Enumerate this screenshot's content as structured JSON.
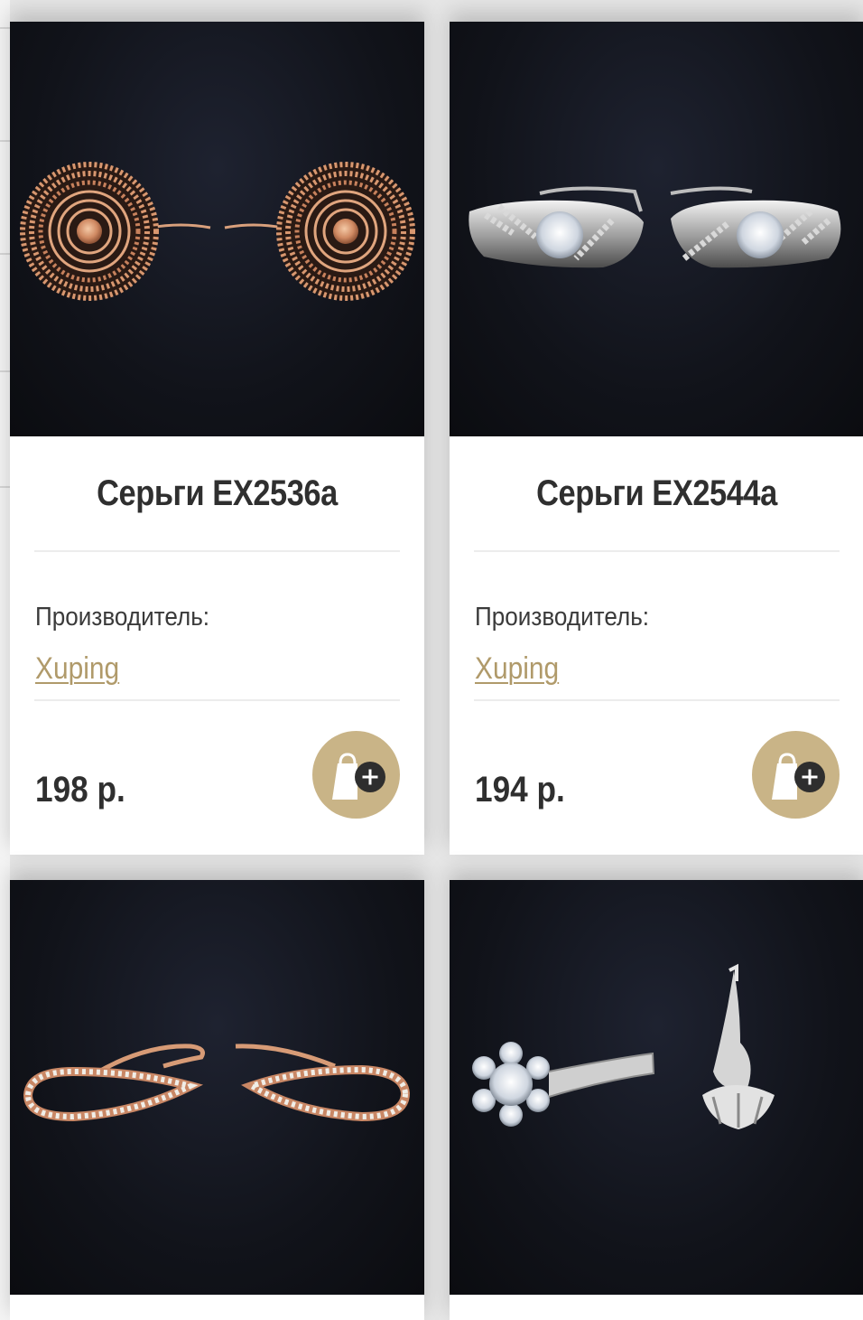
{
  "products": [
    {
      "title": "Серьги EX2536a",
      "maker_label": "Производитель:",
      "maker": "Xuping",
      "price": "198 р.",
      "metal": "rose-gold",
      "style": "spiral-disc-earrings"
    },
    {
      "title": "Серьги EX2544a",
      "maker_label": "Производитель:",
      "maker": "Xuping",
      "price": "194 р.",
      "metal": "silver",
      "style": "crystal-huggie-earrings"
    },
    {
      "metal": "rose-gold",
      "style": "teardrop-crystal-earrings"
    },
    {
      "metal": "silver",
      "style": "flower-crystal-earrings"
    }
  ],
  "colors": {
    "accent_gold": "#c9b487",
    "link_gold": "#b09a6a",
    "text_dark": "#2f2f2f",
    "image_background": "#0f1116"
  },
  "icons": {
    "cart": "shopping-bag-plus-icon"
  }
}
